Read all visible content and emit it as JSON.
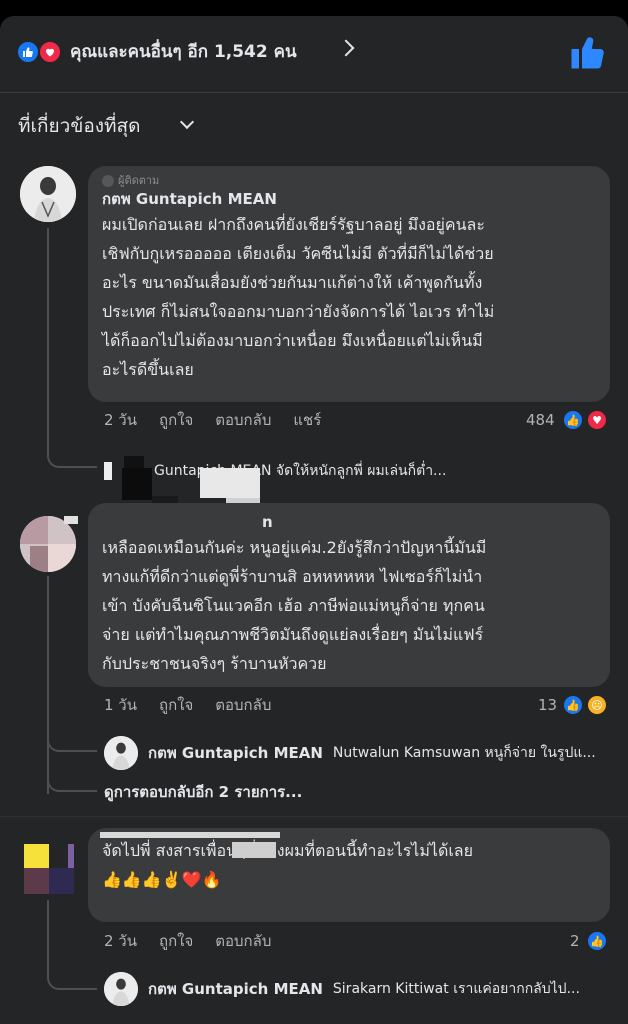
{
  "reactions_bar": {
    "summary": "คุณและคนอื่นๆ อีก 1,542 คน",
    "icons": [
      "like-icon",
      "love-icon"
    ],
    "like_button_icon": "thumbs-up-icon"
  },
  "sort": {
    "label": "ที่เกี่ยวข้องที่สุด"
  },
  "comments": [
    {
      "badge": "ผู้ติดตาม",
      "author": "กตพ Guntapich MEAN",
      "text": "ผมเปิดก่อนเลย ฝากถึงคนที่ยังเชียร์รัฐบาลอยู่ มึงอยู่คนละ\nเชิฟกับกูเหรอออออ เตียงเต็ม วัคซีนไม่มี ตัวที่มีก็ไม่ได้ช่วย\nอะไร ขนาดมันเสื่อมยังช่วยกันมาแก้ต่างให้ เค้าพูดกันทั้ง\nประเทศ ก็ไม่สนใจออกมาบอกว่ายังจัดการได้ ไอเวร ทำไม่\nได้ก็ออกไปไม่ต้องมาบอกว่าเหนื่อย มึงเหนื่อยแต่ไม่เห็นมี\nอะไรดีขึ้นเลย",
      "time": "2 วัน",
      "like": "ถูกใจ",
      "reply": "ตอบกลับ",
      "share": "แชร์",
      "reaction_count": "484",
      "reaction_icons": [
        "like-icon",
        "love-icon"
      ],
      "reply_preview": {
        "name": "",
        "text": "Guntapich MEAN จัดให้หนักลูกพี่ ผมเล่นก็ต่ำ..."
      }
    },
    {
      "author": "n",
      "text": "เหลืออดเหมือนกันค่ะ หนูอยู่แค่ม.2ยังรู้สึกว่าปัญหานี้มันมี\nทางแก้ที่ดีกว่าแต่ดูพี่ร้าบานสิ อหหหหหห ไฟเซอร์ก็ไม่นำ\nเข้า บังคับฉีนซิโนแวคอีก เฮ้อ ภาษีพ่อแม่หนูก็จ่าย ทุกคน\nจ่าย แต่ทำไมคุณภาพชีวิตมันถึงดูแย่ลงเรื่อยๆ มันไม่แฟร์\nกับประชาชนจริงๆ ร้าบานหัวควย",
      "time": "1 วัน",
      "like": "ถูกใจ",
      "reply": "ตอบกลับ",
      "reaction_count": "13",
      "reaction_icons": [
        "like-icon",
        "sad-icon"
      ],
      "reply_preview": {
        "name": "กตพ Guntapich MEAN",
        "text": "Nutwalun Kamsuwan หนูก็จ่าย ในรูปแ..."
      },
      "more_replies": "ดูการตอบกลับอีก 2 รายการ..."
    },
    {
      "author": "",
      "text": "จัดไปพี่ สงสารเพื่อนๆพี่น้องผมที่ตอนนี้ทำอะไรไม่ได้เลย\n👍👍👍✌️❤️🔥",
      "time": "2 วัน",
      "like": "ถูกใจ",
      "reply": "ตอบกลับ",
      "reaction_count": "2",
      "reaction_icons": [
        "like-icon"
      ],
      "reply_preview": {
        "name": "กตพ Guntapich MEAN",
        "text": "Sirakarn Kittiwat เราแค่อยากกลับไป..."
      }
    }
  ],
  "colors": {
    "background": "#242526",
    "bubble": "#3a3b3c",
    "like": "#1877f2",
    "love": "#f02849",
    "sad": "#f7b125"
  }
}
